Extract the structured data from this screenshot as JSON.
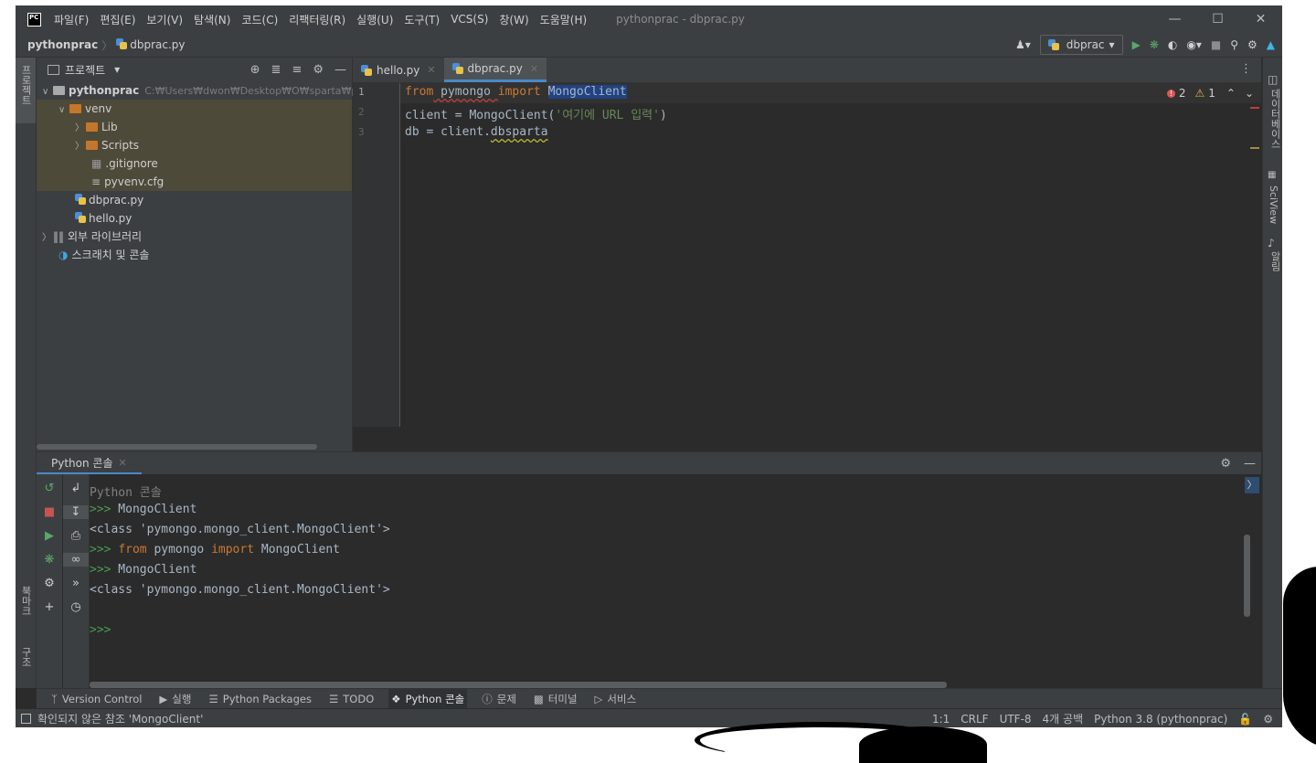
{
  "app": {
    "window_title": "pythonprac - dbprac.py",
    "logo": "PC",
    "menu": [
      "파일(F)",
      "편집(E)",
      "보기(V)",
      "탐색(N)",
      "코드(C)",
      "리팩터링(R)",
      "실행(U)",
      "도구(T)",
      "VCS(S)",
      "창(W)",
      "도움말(H)"
    ]
  },
  "breadcrumb": {
    "project": "pythonprac",
    "file": "dbprac.py"
  },
  "run_config": {
    "name": "dbprac"
  },
  "left_strip": {
    "project_tab": "프로젝트",
    "bookmarks_tab": "북마크",
    "structure_tab": "구조"
  },
  "right_strip": {
    "database_tab": "데이터베이스",
    "sciview_tab": "SciView",
    "notifications_tab": "알림"
  },
  "project_panel": {
    "title": "프로젝트",
    "tree": [
      {
        "label": "pythonprac",
        "path": "C:₩Users₩dwon₩Desktop₩O₩sparta₩pyth"
      },
      {
        "label": "venv"
      },
      {
        "label": "Lib"
      },
      {
        "label": "Scripts"
      },
      {
        "label": ".gitignore"
      },
      {
        "label": "pyvenv.cfg"
      },
      {
        "label": "dbprac.py"
      },
      {
        "label": "hello.py"
      },
      {
        "label": "외부 라이브러리"
      },
      {
        "label": "스크래치 및 콘솔"
      }
    ]
  },
  "editor": {
    "tabs": [
      {
        "label": "hello.py"
      },
      {
        "label": "dbprac.py"
      }
    ],
    "line_numbers": [
      "1",
      "2",
      "3"
    ],
    "code": {
      "l1_from": "from",
      "l1_module": " pymongo ",
      "l1_import": "import",
      "l1_space": " ",
      "l1_name": "MongoClient",
      "l2_pre": "client = MongoClient(",
      "l2_str": "'여기에 URL 입력'",
      "l2_post": ")",
      "l3_pre": "db = client.",
      "l3_attr": "dbsparta"
    },
    "inspections": {
      "errors": "2",
      "warnings": "1"
    }
  },
  "console": {
    "tab_label": "Python 콘솔",
    "header": "Python 콘솔",
    "prompt": ">>>",
    "lines": {
      "l1": " MongoClient",
      "l2": "<class 'pymongo.mongo_client.MongoClient'>",
      "l3_from": "from",
      "l3_module": " pymongo ",
      "l3_import": "import",
      "l3_name": " MongoClient",
      "l4": " MongoClient",
      "l5": "<class 'pymongo.mongo_client.MongoClient'>"
    }
  },
  "bottom_tabs": [
    "Version Control",
    "실행",
    "Python Packages",
    "TODO",
    "Python 콘솔",
    "문제",
    "터미널",
    "서비스"
  ],
  "status": {
    "message": "확인되지 않은 참조 'MongoClient'",
    "position": "1:1",
    "line_sep": "CRLF",
    "encoding": "UTF-8",
    "indent": "4개 공백",
    "interpreter": "Python 3.8 (pythonprac)"
  },
  "colors": {
    "keyword": "#cc7832",
    "string": "#6a8759",
    "prompt": "#499c54",
    "accent": "#4a88c7",
    "error": "#e05555"
  }
}
